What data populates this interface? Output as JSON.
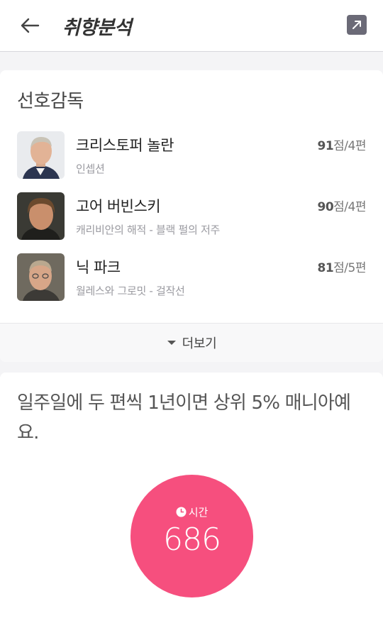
{
  "header": {
    "title": "취향분석"
  },
  "directors": {
    "section_title": "선호감독",
    "items": [
      {
        "name": "크리스토퍼 놀란",
        "works": "인셉션",
        "score": "91",
        "score_suffix": "점/4편"
      },
      {
        "name": "고어 버빈스키",
        "works": "캐리비안의 해적 - 블랙 펄의 저주",
        "score": "90",
        "score_suffix": "점/4편"
      },
      {
        "name": "닉 파크",
        "works": "월레스와 그로밋 - 걸작선",
        "score": "81",
        "score_suffix": "점/5편"
      }
    ],
    "more_label": "더보기"
  },
  "stats": {
    "headline": "일주일에 두 편씩 1년이면 상위 5% 매니아예요.",
    "time_label": "시간",
    "time_value": "686",
    "accent_color": "#f64f7e"
  }
}
